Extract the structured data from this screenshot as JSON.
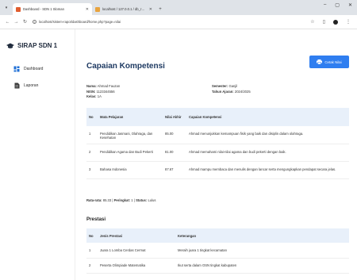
{
  "browser": {
    "tabs": [
      {
        "title": "Dashboard - SDN 1 Sloman",
        "active": true,
        "color": "#e05d2f"
      },
      {
        "title": "localhost / 127.0.0.1 / db_rapor",
        "active": false,
        "color": "#e8a33d"
      }
    ],
    "url": "localhost/sistem-rapot/dashboard/home.php?page=nilai"
  },
  "sidebar": {
    "brand": "SIRAP SDN 1",
    "items": [
      {
        "label": "Dashboard",
        "icon": "dashboard-icon"
      },
      {
        "label": "Laporan",
        "icon": "report-icon"
      }
    ]
  },
  "header": {
    "title": "Capaian Kompetensi",
    "print_label": "Cetak Nilai"
  },
  "student": {
    "name_label": "Nama:",
    "name": "Ahmad Fauzan",
    "nisn_label": "NISN:",
    "nisn": "1123344556",
    "class_label": "Kelas:",
    "class": "1A",
    "semester_label": "Semester:",
    "semester": "Ganjil",
    "year_label": "Tahun Ajaran:",
    "year": "2024/2025"
  },
  "grades": {
    "headers": {
      "no": "No",
      "subject": "Mata Pelajaran",
      "score": "Nilai Akhir",
      "competency": "Capaian Kompetensi"
    },
    "rows": [
      {
        "no": "1",
        "subject": "Pendidikan Jasmani, Olahraga, dan Kesehatan",
        "score": "85.00",
        "competency": "Ahmad menunjukkan kemampuan fisik yang baik dan disiplin dalam olahraga."
      },
      {
        "no": "2",
        "subject": "Pendidikan Agama dan Budi Pekerti",
        "score": "81.00",
        "competency": "Ahmad memahami nilai-nilai agama dan budi pekerti dengan baik."
      },
      {
        "no": "3",
        "subject": "Bahasa Indonesia",
        "score": "87.67",
        "competency": "Ahmad mampu membaca dan menulis dengan lancar serta mengungkapkan pendapat secara jelas."
      }
    ]
  },
  "summary": {
    "avg_label": "Rata-rata:",
    "avg": "85.33",
    "rank_label": "Peringkat:",
    "rank": "1",
    "status_label": "Status:",
    "status": "Lulus"
  },
  "prestasi": {
    "title": "Prestasi",
    "headers": {
      "no": "No",
      "type": "Jenis Prestasi",
      "note": "Keterangan"
    },
    "rows": [
      {
        "no": "1",
        "type": "Juara 1 Lomba Cerdas Cermat",
        "note": "Meraih juara 1 tingkat kecamatan"
      },
      {
        "no": "2",
        "type": "Peserta Olimpiade Matematika",
        "note": "Ikut serta dalam OSN tingkat kabupaten"
      }
    ]
  },
  "colors": {
    "primary": "#2f7ef0",
    "title": "#1e3a62",
    "table_header": "#e8f0fa"
  }
}
